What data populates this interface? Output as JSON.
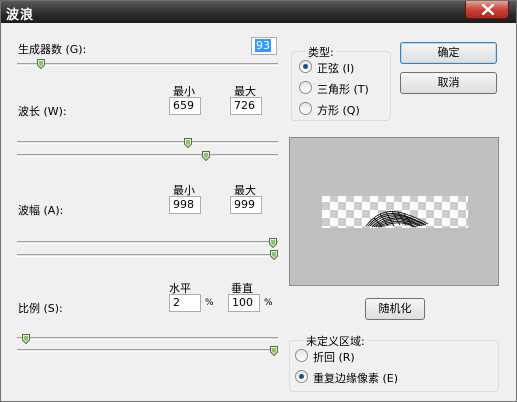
{
  "window": {
    "title": "波浪"
  },
  "generators": {
    "label": "生成器数 (G):",
    "value": "93",
    "slider": 0.08
  },
  "wavelength": {
    "label": "波长 (W):",
    "min_label": "最小",
    "max_label": "最大",
    "min": "659",
    "max": "726",
    "slider_min": 0.66,
    "slider_max": 0.73
  },
  "amplitude": {
    "label": "波幅 (A):",
    "min_label": "最小",
    "max_label": "最大",
    "min": "998",
    "max": "999",
    "slider_min": 0.998,
    "slider_max": 0.999
  },
  "scale": {
    "label": "比例 (S):",
    "h_label": "水平",
    "v_label": "垂直",
    "h": "2",
    "v": "100",
    "unit": "%",
    "slider_h": 0.02,
    "slider_v": 1.0
  },
  "type_group": {
    "title": "类型:",
    "options": [
      {
        "label": "正弦 (I)",
        "selected": true
      },
      {
        "label": "三角形 (T)",
        "selected": false
      },
      {
        "label": "方形 (Q)",
        "selected": false
      }
    ]
  },
  "buttons": {
    "ok": "确定",
    "cancel": "取消",
    "randomize": "随机化"
  },
  "undefined_group": {
    "title": "未定义区域:",
    "options": [
      {
        "label": "折回 (R)",
        "selected": false
      },
      {
        "label": "重复边缘像素 (E)",
        "selected": true
      }
    ]
  }
}
